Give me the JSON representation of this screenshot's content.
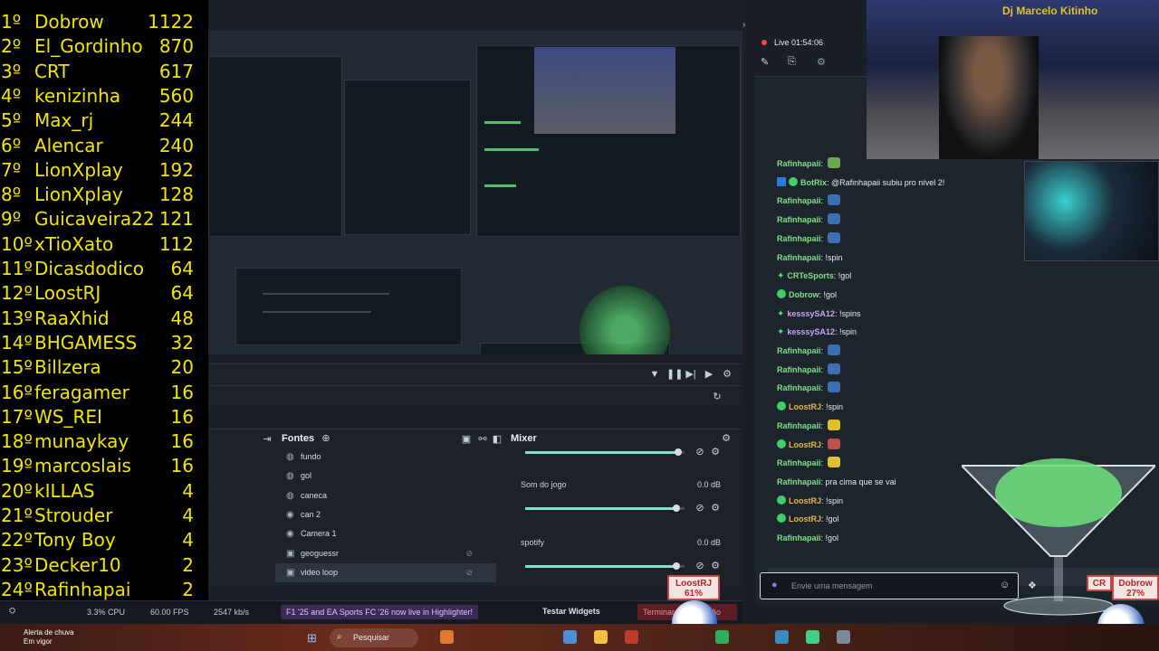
{
  "leaderboard": [
    {
      "rank": "1º",
      "name": "Dobrow",
      "score": "1122"
    },
    {
      "rank": "2º",
      "name": "El_Gordinho",
      "score": "870"
    },
    {
      "rank": "3º",
      "name": "CRT",
      "score": "617"
    },
    {
      "rank": "4º",
      "name": "kenizinha",
      "score": "560"
    },
    {
      "rank": "5º",
      "name": "Max_rj",
      "score": "244"
    },
    {
      "rank": "6º",
      "name": "Alencar",
      "score": "240"
    },
    {
      "rank": "7º",
      "name": "LionXplay",
      "score": "192"
    },
    {
      "rank": "8º",
      "name": "LionXplay",
      "score": "128"
    },
    {
      "rank": "9º",
      "name": "Guicaveira22",
      "score": "121"
    },
    {
      "rank": "10º",
      "name": "xTioXato",
      "score": "112"
    },
    {
      "rank": "11º",
      "name": "Dicasdodico",
      "score": "64"
    },
    {
      "rank": "12º",
      "name": "LoostRJ",
      "score": "64"
    },
    {
      "rank": "13º",
      "name": "RaaXhid",
      "score": "48"
    },
    {
      "rank": "14º",
      "name": "BHGAMESS",
      "score": "32"
    },
    {
      "rank": "15º",
      "name": "Billzera",
      "score": "20"
    },
    {
      "rank": "16º",
      "name": "feragamer",
      "score": "16"
    },
    {
      "rank": "17º",
      "name": "WS_REI",
      "score": "16"
    },
    {
      "rank": "18º",
      "name": "munaykay",
      "score": "16"
    },
    {
      "rank": "19º",
      "name": "marcoslais",
      "score": "16"
    },
    {
      "rank": "20º",
      "name": "kILLAS",
      "score": "4"
    },
    {
      "rank": "21º",
      "name": "Strouder",
      "score": "4"
    },
    {
      "rank": "22º",
      "name": "Tony Boy",
      "score": "4"
    },
    {
      "rank": "23º",
      "name": "Decker10",
      "score": "2"
    },
    {
      "rank": "24º",
      "name": "Rafinhapai",
      "score": "2"
    }
  ],
  "obs": {
    "fontes_title": "Fontes",
    "mixer_title": "Mixer",
    "sources": [
      {
        "label": "fundo",
        "icon": "globe-icon"
      },
      {
        "label": "gol",
        "icon": "globe-icon"
      },
      {
        "label": "caneca",
        "icon": "globe-icon"
      },
      {
        "label": "can 2",
        "icon": "camera-icon"
      },
      {
        "label": "Camera 1",
        "icon": "camera-icon"
      },
      {
        "label": "geoguessr",
        "icon": "window-icon"
      },
      {
        "label": "video loop",
        "icon": "window-icon",
        "selected": true
      }
    ],
    "mixer": [
      {
        "label": "",
        "db": "",
        "level": 0.96
      },
      {
        "label": "Som do jogo",
        "db": "0.0 dB",
        "level": 0.95
      },
      {
        "label": "spotify",
        "db": "0.0 dB",
        "level": 0.95
      }
    ],
    "status": {
      "cpu": "3.3% CPU",
      "fps": "60.00 FPS",
      "kbps": "2547 kb/s",
      "highlighter": "F1 '25 and EA Sports FC '26 now live in Highlighter!",
      "testar": "Testar Widgets",
      "terminar": "Terminar transmissão"
    }
  },
  "chat": {
    "live_label": "Live 01:54:06",
    "input_placeholder": "Envie uma mensagem",
    "messages": [
      {
        "user": "Rafinhapaii",
        "text": "",
        "badge": "none",
        "emote": "#6aa84f"
      },
      {
        "user": "BotRix",
        "text": "@Rafinhapaii subiu pro nível 2!",
        "badge": "bot",
        "emote": ""
      },
      {
        "user": "Rafinhapaii",
        "text": "",
        "badge": "none",
        "emote": "#3d6fb5"
      },
      {
        "user": "Rafinhapaii",
        "text": "",
        "badge": "none",
        "emote": "#3d6fb5"
      },
      {
        "user": "Rafinhapaii",
        "text": "",
        "badge": "none",
        "emote": "#3d6fb5"
      },
      {
        "user": "Rafinhapaii",
        "text": "!spin",
        "badge": "none",
        "emote": ""
      },
      {
        "user": "CRTeSports",
        "text": "!gol",
        "badge": "star",
        "emote": ""
      },
      {
        "user": "Dobrow",
        "text": "!gol",
        "badge": "check",
        "emote": ""
      },
      {
        "user": "kesssySA12",
        "text": "!spins",
        "badge": "star",
        "emote": ""
      },
      {
        "user": "kesssySA12",
        "text": "!spin",
        "badge": "star",
        "emote": ""
      },
      {
        "user": "Rafinhapaii",
        "text": "",
        "badge": "none",
        "emote": "#3d6fb5"
      },
      {
        "user": "Rafinhapaii",
        "text": "",
        "badge": "none",
        "emote": "#3d6fb5"
      },
      {
        "user": "Rafinhapaii",
        "text": "",
        "badge": "none",
        "emote": "#3d6fb5"
      },
      {
        "user": "LoostRJ",
        "text": "!spin",
        "badge": "check",
        "emote": ""
      },
      {
        "user": "Rafinhapaii",
        "text": "",
        "badge": "none",
        "emote": "#e0c030"
      },
      {
        "user": "LoostRJ",
        "text": "",
        "badge": "check",
        "emote": "#c05050"
      },
      {
        "user": "Rafinhapaii",
        "text": "",
        "badge": "none",
        "emote": "#e0c030"
      },
      {
        "user": "Rafinhapaii",
        "text": "pra cima que se vai",
        "badge": "none",
        "emote": ""
      },
      {
        "user": "LoostRJ",
        "text": "!spin",
        "badge": "check",
        "emote": ""
      },
      {
        "user": "LoostRJ",
        "text": "!gol",
        "badge": "check",
        "emote": ""
      },
      {
        "user": "Rafinhapaii",
        "text": "!gol",
        "badge": "none",
        "emote": ""
      }
    ],
    "colors": {
      "rafinha": "#7ee08a",
      "loost": "#e0b94a",
      "crt": "#7ee08a",
      "dobrow": "#7ee08a",
      "kesssy": "#c7a6f0",
      "botrix": "#7ee08a"
    }
  },
  "overlay": {
    "loost_tag": {
      "name": "LoostRJ",
      "pct": "61%"
    },
    "dobrow_tag": {
      "name": "Dobrow",
      "pct": "27%"
    },
    "crt_tag": "CR",
    "webcam_sign": "Dj Marcelo Kitinho"
  },
  "taskbar": {
    "weather_title": "Alerta de chuva",
    "weather_sub": "Em vigor",
    "search": "Pesquisar"
  }
}
